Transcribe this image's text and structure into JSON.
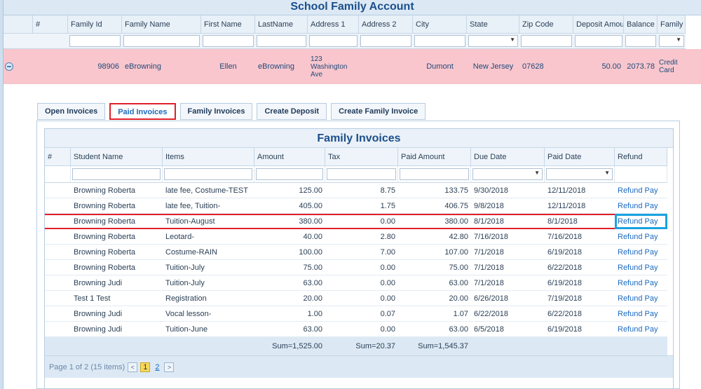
{
  "title": "School Family Account",
  "columns": [
    "#",
    "Family Id",
    "Family Name",
    "First Name",
    "LastName",
    "Address 1",
    "Address 2",
    "City",
    "State",
    "Zip Code",
    "Deposit Amount",
    "Balance",
    "Family A"
  ],
  "family_row": {
    "family_id": "98906",
    "family_name": "eBrowning",
    "first_name": "Ellen",
    "last_name": "eBrowning",
    "address1": "123 Washington Ave",
    "address2": "",
    "city": "Dumont",
    "state": "New Jersey",
    "zip": "07628",
    "deposit": "50.00",
    "balance": "2073.78",
    "family_a": "Credit Card"
  },
  "tabs": [
    "Open Invoices",
    "Paid Invoices",
    "Family Invoices",
    "Create Deposit",
    "Create Family Invoice"
  ],
  "invoices": {
    "title": "Family Invoices",
    "columns": [
      "#",
      "Student Name",
      "Items",
      "Amount",
      "Tax",
      "Paid Amount",
      "Due Date",
      "Paid Date",
      "Refund"
    ],
    "rows": [
      {
        "student": "Browning Roberta",
        "items": "late fee, Costume-TEST",
        "amount": "125.00",
        "tax": "8.75",
        "paid": "133.75",
        "due": "9/30/2018",
        "paid_date": "12/11/2018",
        "refund": "Refund Pay"
      },
      {
        "student": "Browning Roberta",
        "items": "late fee, Tuition-",
        "amount": "405.00",
        "tax": "1.75",
        "paid": "406.75",
        "due": "9/8/2018",
        "paid_date": "12/11/2018",
        "refund": "Refund Pay"
      },
      {
        "student": "Browning Roberta",
        "items": "Tuition-August",
        "amount": "380.00",
        "tax": "0.00",
        "paid": "380.00",
        "due": "8/1/2018",
        "paid_date": "8/1/2018",
        "refund": "Refund Pay"
      },
      {
        "student": "Browning Roberta",
        "items": "Leotard-",
        "amount": "40.00",
        "tax": "2.80",
        "paid": "42.80",
        "due": "7/16/2018",
        "paid_date": "7/16/2018",
        "refund": "Refund Pay"
      },
      {
        "student": "Browning Roberta",
        "items": "Costume-RAIN",
        "amount": "100.00",
        "tax": "7.00",
        "paid": "107.00",
        "due": "7/1/2018",
        "paid_date": "6/19/2018",
        "refund": "Refund Pay"
      },
      {
        "student": "Browning Roberta",
        "items": "Tuition-July",
        "amount": "75.00",
        "tax": "0.00",
        "paid": "75.00",
        "due": "7/1/2018",
        "paid_date": "6/22/2018",
        "refund": "Refund Pay"
      },
      {
        "student": "Browning Judi",
        "items": "Tuition-July",
        "amount": "63.00",
        "tax": "0.00",
        "paid": "63.00",
        "due": "7/1/2018",
        "paid_date": "6/19/2018",
        "refund": "Refund Pay"
      },
      {
        "student": "Test 1 Test",
        "items": "Registration",
        "amount": "20.00",
        "tax": "0.00",
        "paid": "20.00",
        "due": "6/26/2018",
        "paid_date": "7/19/2018",
        "refund": "Refund Pay"
      },
      {
        "student": "Browning Judi",
        "items": "Vocal lesson-",
        "amount": "1.00",
        "tax": "0.07",
        "paid": "1.07",
        "due": "6/22/2018",
        "paid_date": "6/22/2018",
        "refund": "Refund Pay"
      },
      {
        "student": "Browning Judi",
        "items": "Tuition-June",
        "amount": "63.00",
        "tax": "0.00",
        "paid": "63.00",
        "due": "6/5/2018",
        "paid_date": "6/19/2018",
        "refund": "Refund Pay"
      }
    ],
    "sums": {
      "amount": "Sum=1,525.00",
      "tax": "Sum=20.37",
      "paid": "Sum=1,545.37"
    },
    "pager": {
      "info": "Page 1 of 2 (15 items)",
      "page1": "1",
      "page2": "2"
    }
  },
  "colors": {
    "accent_red": "#e0202a",
    "accent_blue": "#1aa3e0",
    "row_pink": "#f9c6cd"
  }
}
